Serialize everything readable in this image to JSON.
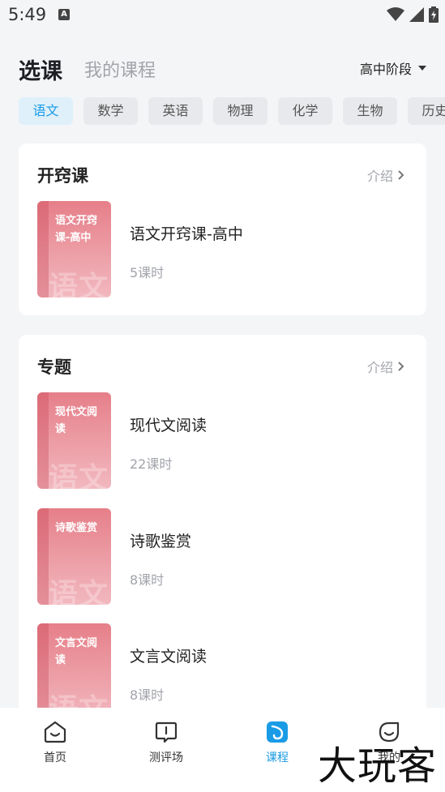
{
  "status": {
    "time": "5:49",
    "a_badge": "A"
  },
  "header": {
    "title": "选课",
    "my_courses": "我的课程",
    "stage": "高中阶段"
  },
  "tabs": [
    "语文",
    "数学",
    "英语",
    "物理",
    "化学",
    "生物",
    "历史"
  ],
  "sections": [
    {
      "title": "开窍课",
      "intro": "介绍",
      "courses": [
        {
          "cover_text": "语文开窍课-高中",
          "watermark": "语文",
          "name": "语文开窍课-高中",
          "hours": "5课时"
        }
      ]
    },
    {
      "title": "专题",
      "intro": "介绍",
      "courses": [
        {
          "cover_text": "现代文阅读",
          "watermark": "语文",
          "name": "现代文阅读",
          "hours": "22课时"
        },
        {
          "cover_text": "诗歌鉴赏",
          "watermark": "语文",
          "name": "诗歌鉴赏",
          "hours": "8课时"
        },
        {
          "cover_text": "文言文阅读",
          "watermark": "语文",
          "name": "文言文阅读",
          "hours": "8课时"
        }
      ]
    }
  ],
  "nav": [
    {
      "label": "首页",
      "icon": "home-icon"
    },
    {
      "label": "测评场",
      "icon": "assessment-icon"
    },
    {
      "label": "课程",
      "icon": "course-icon"
    },
    {
      "label": "我的",
      "icon": "profile-icon"
    }
  ],
  "watermark": "大玩客",
  "colors": {
    "accent": "#1a9be6",
    "cover": "#e67f89"
  }
}
